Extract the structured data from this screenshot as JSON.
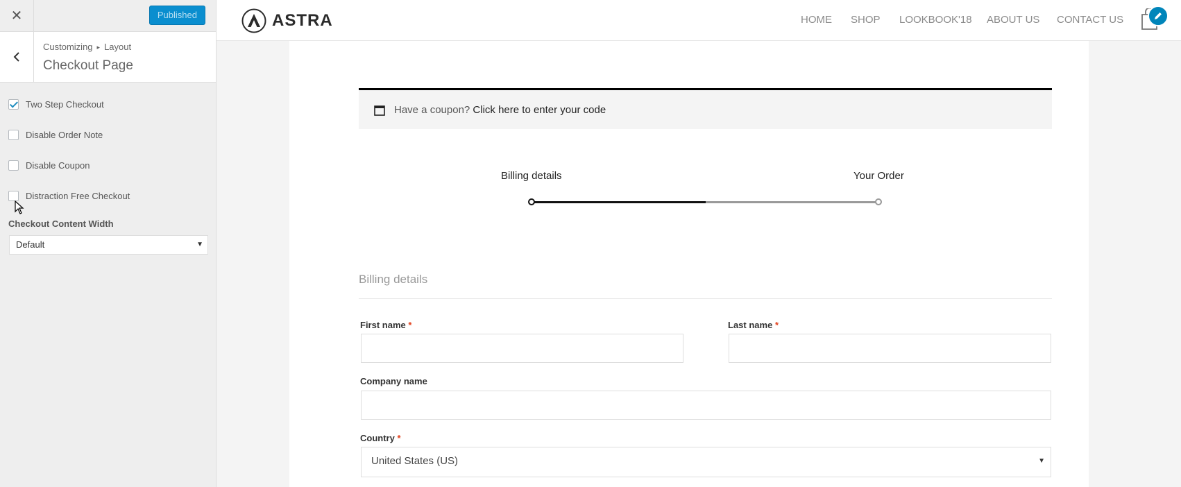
{
  "sidebar": {
    "close_icon": "close-icon",
    "publish_label": "Published",
    "back_icon": "chevron-left-icon",
    "breadcrumb": [
      "Customizing",
      "Layout"
    ],
    "section_title": "Checkout Page",
    "options": [
      {
        "label": "Two Step Checkout",
        "checked": true
      },
      {
        "label": "Disable Order Note",
        "checked": false
      },
      {
        "label": "Disable Coupon",
        "checked": false
      },
      {
        "label": "Distraction Free Checkout",
        "checked": false
      }
    ],
    "width_label": "Checkout Content Width",
    "width_value": "Default"
  },
  "header": {
    "logo_text": "ASTRA",
    "nav": [
      "HOME",
      "SHOP",
      "LOOKBOOK'18",
      "ABOUT US",
      "CONTACT US"
    ],
    "cart_icon": "cart-icon",
    "edit_icon": "pencil-icon"
  },
  "checkout": {
    "coupon_prompt": "Have a coupon?",
    "coupon_link": "Click here to enter your code",
    "steps": [
      "Billing details",
      "Your Order"
    ],
    "billing_heading": "Billing details",
    "fields": {
      "first_name": "First name",
      "last_name": "Last name",
      "company": "Company name",
      "country": "Country",
      "country_value": "United States (US)",
      "required_mark": "*"
    }
  },
  "colors": {
    "publish_button": "#0a8ecf",
    "required": "#e2401c",
    "checkbox_tick": "#1e8cbe"
  }
}
